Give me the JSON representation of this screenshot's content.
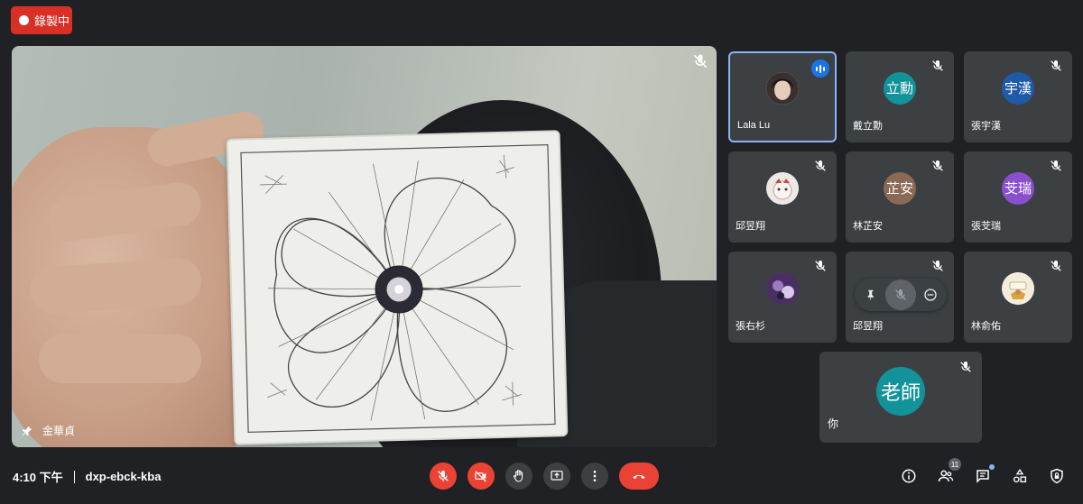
{
  "recording": {
    "label": "錄製中"
  },
  "stage": {
    "presenter_name": "金華貞"
  },
  "participants": [
    {
      "name": "Lala Lu",
      "avatar_text": "",
      "avatar_color": "#c7b9a8",
      "speaking": true
    },
    {
      "name": "戴立勳",
      "avatar_text": "立勳",
      "avatar_color": "#12939a"
    },
    {
      "name": "張宇漢",
      "avatar_text": "宇漢",
      "avatar_color": "#1e5aa8"
    },
    {
      "name": "邱昱翔",
      "avatar_text": "",
      "avatar_color": "#e8e3e0"
    },
    {
      "name": "林芷安",
      "avatar_text": "芷安",
      "avatar_color": "#8a6a55"
    },
    {
      "name": "張芠瑞",
      "avatar_text": "芠瑞",
      "avatar_color": "#8a4fcf"
    },
    {
      "name": "張右杉",
      "avatar_text": "",
      "avatar_color": "#5b3b73"
    },
    {
      "name": "邱昱翔",
      "avatar_text": "",
      "avatar_color": "#3c4043"
    },
    {
      "name": "林俞佑",
      "avatar_text": "",
      "avatar_color": "#f3ecd9"
    }
  ],
  "self": {
    "name": "你",
    "avatar_text": "老師",
    "avatar_color": "#12939a"
  },
  "bottom": {
    "time": "4:10 下午",
    "meeting_code": "dxp-ebck-kba"
  },
  "people_count": "11",
  "colors": {
    "background": "#202124",
    "tile": "#3c4043",
    "danger": "#ea4335",
    "active": "#8ab4f8"
  }
}
